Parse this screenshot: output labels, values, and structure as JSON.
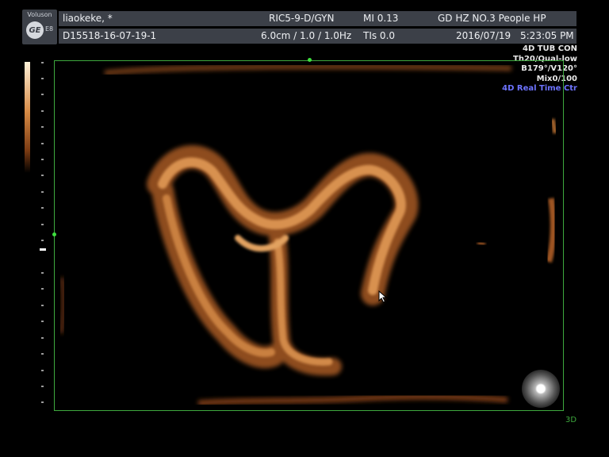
{
  "header": {
    "logo": {
      "brand": "Voluson",
      "mark": "GE",
      "model": "E8"
    },
    "patient_name": "liaokeke, *",
    "patient_id": "D15518-16-07-19-1",
    "probe": "RIC5-9-D/GYN",
    "probe_settings": "6.0cm / 1.0 / 1.0Hz",
    "mi": "MI 0.13",
    "tis": "TIs  0.0",
    "hospital": "GD HZ NO.3 People HP",
    "date": "2016/07/19",
    "time": "5:23:05 PM"
  },
  "image_info": {
    "lines": [
      "4D TUB CON",
      "Th20/Qual-low",
      "B179°/V120°",
      "Mix0/100"
    ],
    "mode": "4D Real Time Ctr"
  },
  "view_label": "3D",
  "colors": {
    "header_bg": "#3c4048",
    "frame_green": "#3ea93e",
    "mode_blue": "#6d73ff",
    "tissue": "#c27a3d"
  },
  "icons": [
    "ge-logo-icon",
    "mouse-cursor-icon",
    "trackball-icon"
  ]
}
